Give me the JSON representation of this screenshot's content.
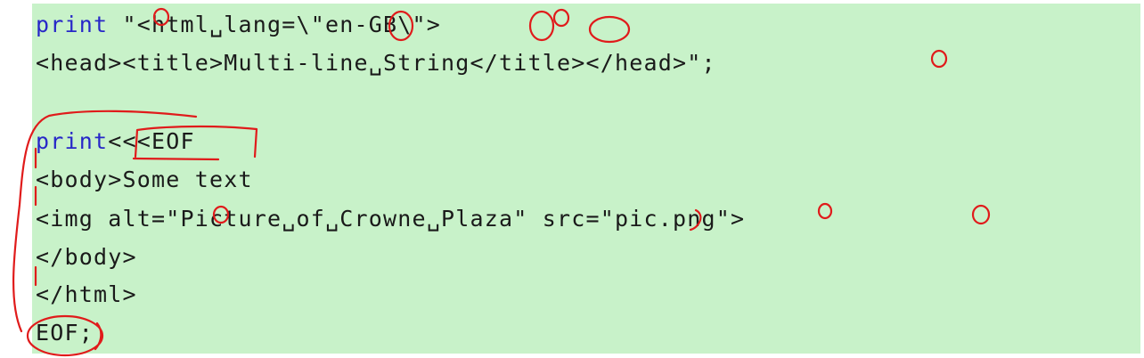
{
  "code": {
    "line1": {
      "keyword": "print",
      "rest": " \"<html␣lang=\\\"en-GB\\\">"
    },
    "line2": "<head><title>Multi-line␣String</title></head>\";",
    "line3": {
      "keyword": "print",
      "rest": "<<<EOF"
    },
    "line4": "<body>Some text",
    "line5": "<img alt=\"Picture␣of␣Crowne␣Plaza\" src=\"pic.png\">",
    "line6": "</body>",
    "line7": "</html>",
    "line8": "EOF;"
  },
  "colors": {
    "background": "#c8f2c9",
    "keyword": "#2727c8",
    "text": "#1a1a1a",
    "annotation": "#e01b1b"
  }
}
